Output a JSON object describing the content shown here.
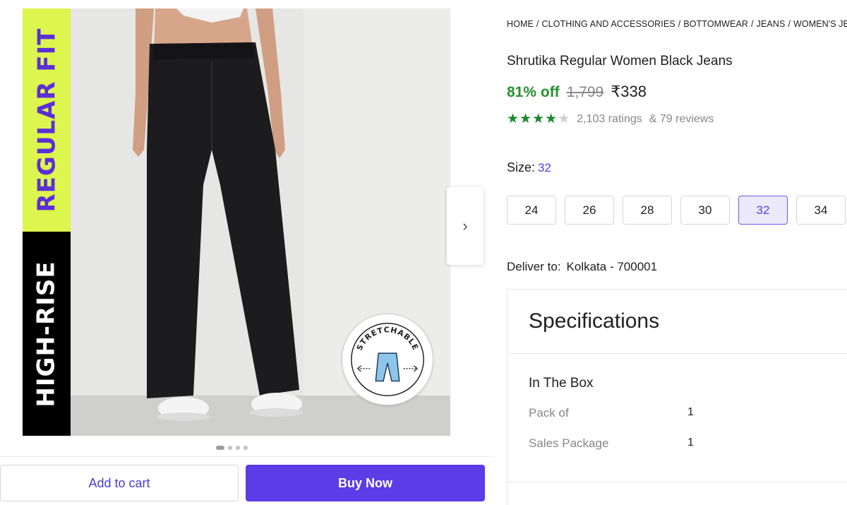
{
  "gallery": {
    "band_top_text": "REGULAR FIT",
    "band_bottom_text": "HIGH-RISE",
    "badge_text": "STRETCHABLE",
    "next_arrow": "chevron-right-icon",
    "dots_total": 4,
    "dots_active": 1
  },
  "actions": {
    "add_to_cart": "Add to cart",
    "buy_now": "Buy Now"
  },
  "breadcrumb": [
    "HOME",
    "CLOTHING AND ACCESSORIES",
    "BOTTOMWEAR",
    "JEANS",
    "WOMEN'S JEA"
  ],
  "product": {
    "title": "Shrutika Regular Women Black Jeans",
    "discount": "81% off",
    "mrp": "1,799",
    "price": "₹338",
    "rating_stars": 4,
    "ratings": "2,103 ratings",
    "reviews": "& 79 reviews"
  },
  "size": {
    "label": "Size:",
    "selected": "32",
    "options": [
      "24",
      "26",
      "28",
      "30",
      "32",
      "34"
    ]
  },
  "delivery": {
    "label": "Deliver to:",
    "location": "Kolkata - 700001"
  },
  "specifications": {
    "heading": "Specifications",
    "section": "In The Box",
    "rows": [
      {
        "key": "Pack of",
        "value": "1"
      },
      {
        "key": "Sales Package",
        "value": "1"
      }
    ]
  },
  "colors": {
    "accent": "#5b3ce6",
    "discount_green": "#25922f",
    "band_lime": "#dcf64d",
    "band_purple_text": "#5b2fd6"
  }
}
